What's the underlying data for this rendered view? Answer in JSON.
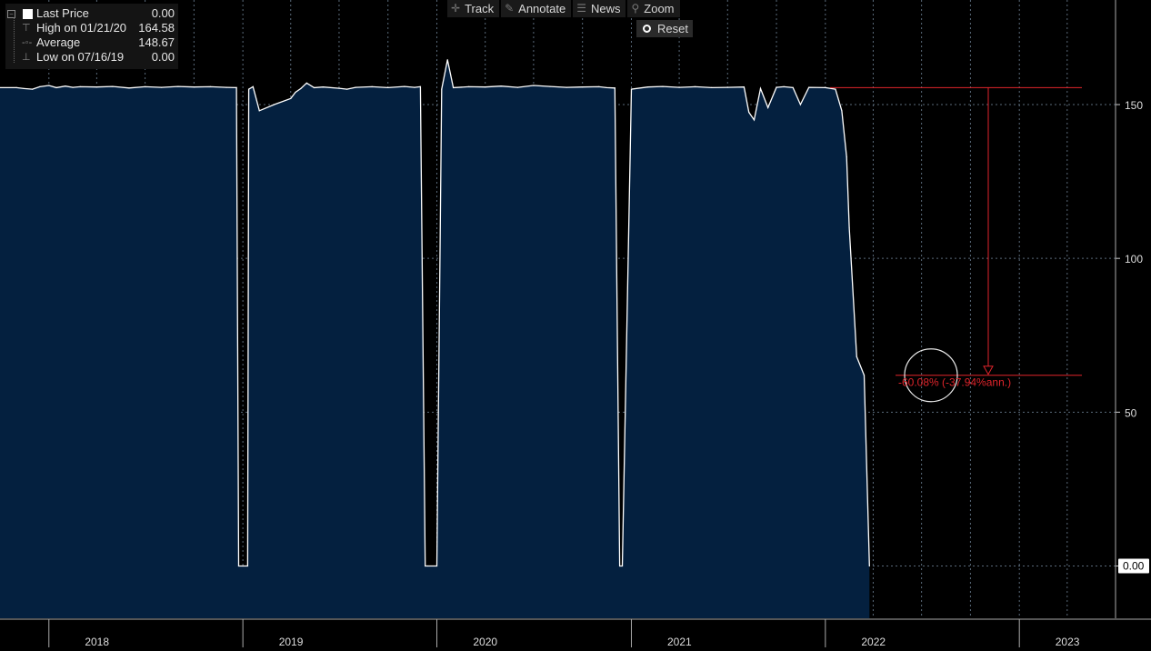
{
  "legend": {
    "rows": [
      {
        "label": "Last Price",
        "value": "0.00"
      },
      {
        "label": "High on 01/21/20",
        "value": "164.58"
      },
      {
        "label": "Average",
        "value": "148.67"
      },
      {
        "label": "Low on 07/16/19",
        "value": "0.00"
      }
    ],
    "icons": [
      "high-marker-icon",
      "average-marker-icon",
      "low-marker-icon"
    ]
  },
  "toolbar": {
    "track": "Track",
    "annotate": "Annotate",
    "news": "News",
    "zoom": "Zoom",
    "reset": "Reset"
  },
  "colors": {
    "background": "#000000",
    "area_fill": "#04203f",
    "line": "#ffffff",
    "annotation": "#e0242b",
    "grid": "#5a6a7a"
  },
  "chart_data": {
    "type": "area",
    "series": [
      {
        "name": "Last Price",
        "x": [
          "2017-11-01",
          "2017-11-15",
          "2017-12-01",
          "2017-12-15",
          "2018-01-01",
          "2018-01-15",
          "2018-02-01",
          "2018-02-15",
          "2018-03-01",
          "2018-04-01",
          "2018-05-01",
          "2018-06-01",
          "2018-07-01",
          "2018-08-01",
          "2018-09-01",
          "2018-10-01",
          "2018-11-01",
          "2018-12-01",
          "2018-12-20",
          "2018-12-24",
          "2019-01-01",
          "2019-01-10",
          "2019-01-12",
          "2019-01-20",
          "2019-02-01",
          "2019-03-01",
          "2019-04-01",
          "2019-04-10",
          "2019-04-20",
          "2019-05-01",
          "2019-05-15",
          "2019-06-01",
          "2019-07-01",
          "2019-07-16",
          "2019-08-01",
          "2019-09-01",
          "2019-10-01",
          "2019-11-01",
          "2019-11-20",
          "2019-12-01",
          "2019-12-10",
          "2019-12-15",
          "2020-01-01",
          "2020-01-10",
          "2020-01-21",
          "2020-02-01",
          "2020-03-01",
          "2020-04-01",
          "2020-05-01",
          "2020-06-01",
          "2020-07-01",
          "2020-08-01",
          "2020-09-01",
          "2020-10-01",
          "2020-11-01",
          "2020-11-15",
          "2020-12-01",
          "2020-12-10",
          "2020-12-15",
          "2021-01-01",
          "2021-02-01",
          "2021-03-01",
          "2021-04-01",
          "2021-05-01",
          "2021-06-01",
          "2021-07-01",
          "2021-08-01",
          "2021-08-10",
          "2021-08-20",
          "2021-09-01",
          "2021-09-15",
          "2021-10-01",
          "2021-10-15",
          "2021-11-01",
          "2021-11-15",
          "2021-12-01",
          "2022-01-01",
          "2022-01-20",
          "2022-02-01",
          "2022-02-10",
          "2022-02-15",
          "2022-03-01",
          "2022-03-15",
          "2022-03-25"
        ],
        "values": [
          155.5,
          155.2,
          155.0,
          155.8,
          156.2,
          155.5,
          156.0,
          155.6,
          155.8,
          155.7,
          155.9,
          155.4,
          155.8,
          155.6,
          155.9,
          155.7,
          155.8,
          155.6,
          155.5,
          0.0,
          0.0,
          0.0,
          155.0,
          155.8,
          148.0,
          150.0,
          152.0,
          154.0,
          155.2,
          157.0,
          155.5,
          155.7,
          155.3,
          155.0,
          155.6,
          155.8,
          155.5,
          155.9,
          155.6,
          155.8,
          0.0,
          0.0,
          0.0,
          155.0,
          164.58,
          155.5,
          155.8,
          155.7,
          156.0,
          155.6,
          156.2,
          155.9,
          155.6,
          155.7,
          155.8,
          155.5,
          155.4,
          0.0,
          0.0,
          155.0,
          155.7,
          155.9,
          155.6,
          155.8,
          155.5,
          155.6,
          155.7,
          147.5,
          145.0,
          155.2,
          149.0,
          155.6,
          155.8,
          155.5,
          150.0,
          155.6,
          155.5,
          155.0,
          148.0,
          133.0,
          110.0,
          68.0,
          62.0,
          0.0
        ]
      }
    ],
    "ylim": [
      -17,
      184
    ],
    "y_ticks": [
      "150",
      "100",
      "50"
    ],
    "last_value_label": "0.00",
    "x_labels": [
      "2018",
      "2019",
      "2020",
      "2021",
      "2022",
      "2023"
    ],
    "xlim": [
      "2017-10-01",
      "2023-07-01"
    ],
    "grid": true,
    "annotation": {
      "start_date": "2022-01-10",
      "end_date": "2022-03-15",
      "start_value": 155.5,
      "end_value": 62.0,
      "label": "-60.08% (-37.94%ann.)"
    },
    "legend_position": "top-left"
  }
}
